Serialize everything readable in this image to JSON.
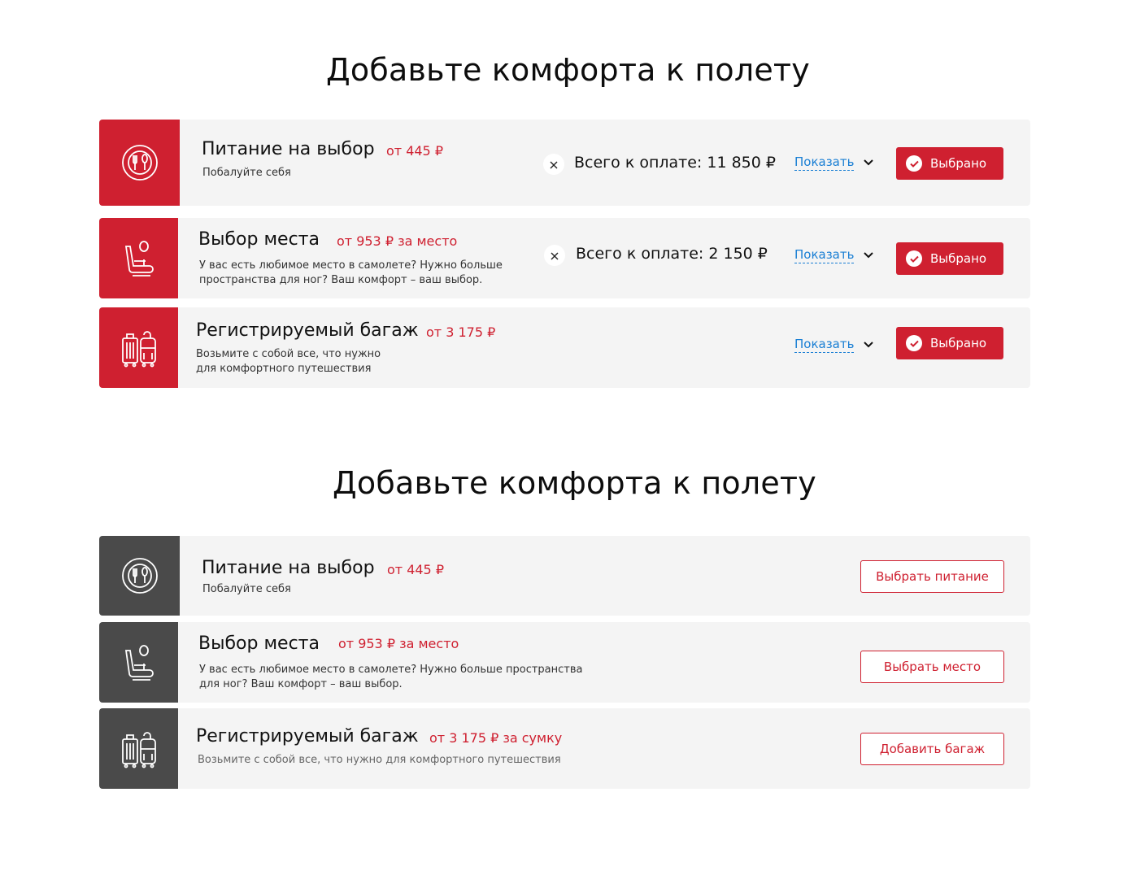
{
  "selected_state": {
    "heading": "Добавьте комфорта к полету",
    "cards": [
      {
        "title": "Питание на выбор",
        "price": "от 445 ₽",
        "description": [
          "Побалуйте себя"
        ],
        "total": "Всего к оплате: 11 850 ₽",
        "show_label": "Показать",
        "button_label": "Выбрано",
        "icon": "meal-plate-icon"
      },
      {
        "title": "Выбор места",
        "price": "от 953 ₽ за место",
        "description": [
          "У вас есть любимое место в самолете? Нужно больше",
          "пространства для ног? Ваш комфорт – ваш выбор."
        ],
        "total": "Всего к оплате: 2 150 ₽",
        "show_label": "Показать",
        "button_label": "Выбрано",
        "icon": "seat-icon"
      },
      {
        "title": "Регистрируемый багаж",
        "price": "от 3 175 ₽",
        "description": [
          "Возьмите с собой все, что нужно",
          "для комфортного путешествия"
        ],
        "show_label": "Показать",
        "button_label": "Выбрано",
        "icon": "luggage-icon"
      }
    ]
  },
  "default_state": {
    "heading": "Добавьте комфорта к полету",
    "cards": [
      {
        "title": "Питание на выбор",
        "price": "от 445 ₽",
        "description": [
          "Побалуйте себя"
        ],
        "button_label": "Выбрать питание",
        "icon": "meal-plate-icon"
      },
      {
        "title": "Выбор места",
        "price": "от 953 ₽ за место",
        "description": [
          "У вас есть любимое место в самолете? Нужно больше пространства",
          "для ног? Ваш комфорт – ваш выбор."
        ],
        "button_label": "Выбрать место",
        "icon": "seat-icon"
      },
      {
        "title": "Регистрируемый багаж",
        "price": "от 3 175 ₽ за сумку",
        "description": [
          "Возьмите с собой все, что нужно для комфортного путешествия"
        ],
        "button_label": "Добавить багаж",
        "icon": "luggage-icon"
      }
    ]
  },
  "colors": {
    "accent": "#cf2030",
    "link": "#1a7fd4",
    "card_bg": "#f4f4f4",
    "icon_dark": "#4a4a4a"
  }
}
